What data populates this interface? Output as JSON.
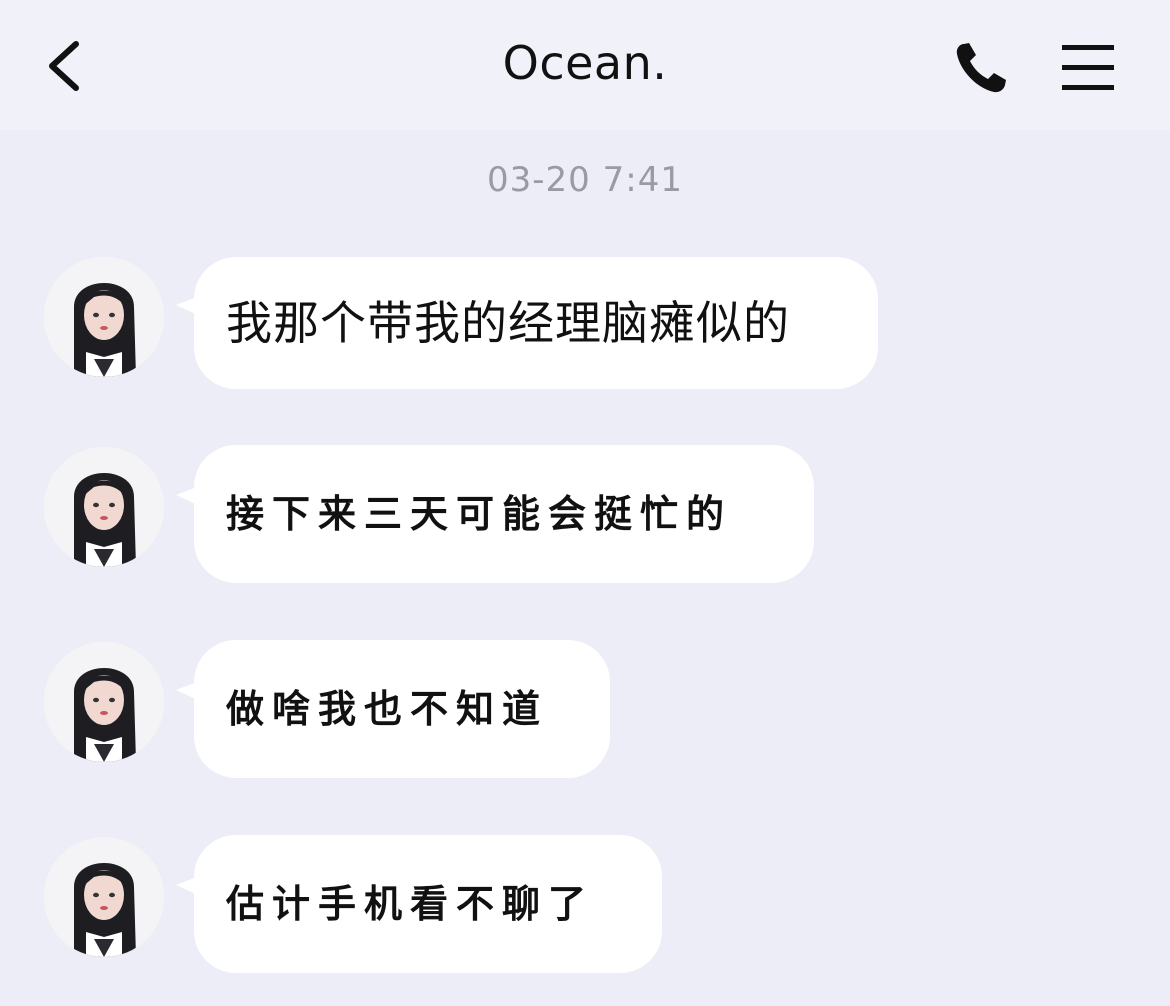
{
  "header": {
    "title": "Ocean."
  },
  "icons": {
    "back": "chevron-left-icon",
    "call": "phone-icon",
    "menu": "hamburger-menu-icon"
  },
  "chat": {
    "timestamp": "03-20 7:41",
    "messages": [
      {
        "text": "我那个带我的经理脑瘫似的"
      },
      {
        "text": "接下来三天可能会挺忙的"
      },
      {
        "text": "做啥我也不知道"
      },
      {
        "text": "估计手机看不聊了"
      }
    ]
  },
  "colors": {
    "background": "#ededf7",
    "header": "#f0f1f9",
    "bubble": "#ffffff",
    "timestamp": "#9a9aa4"
  }
}
